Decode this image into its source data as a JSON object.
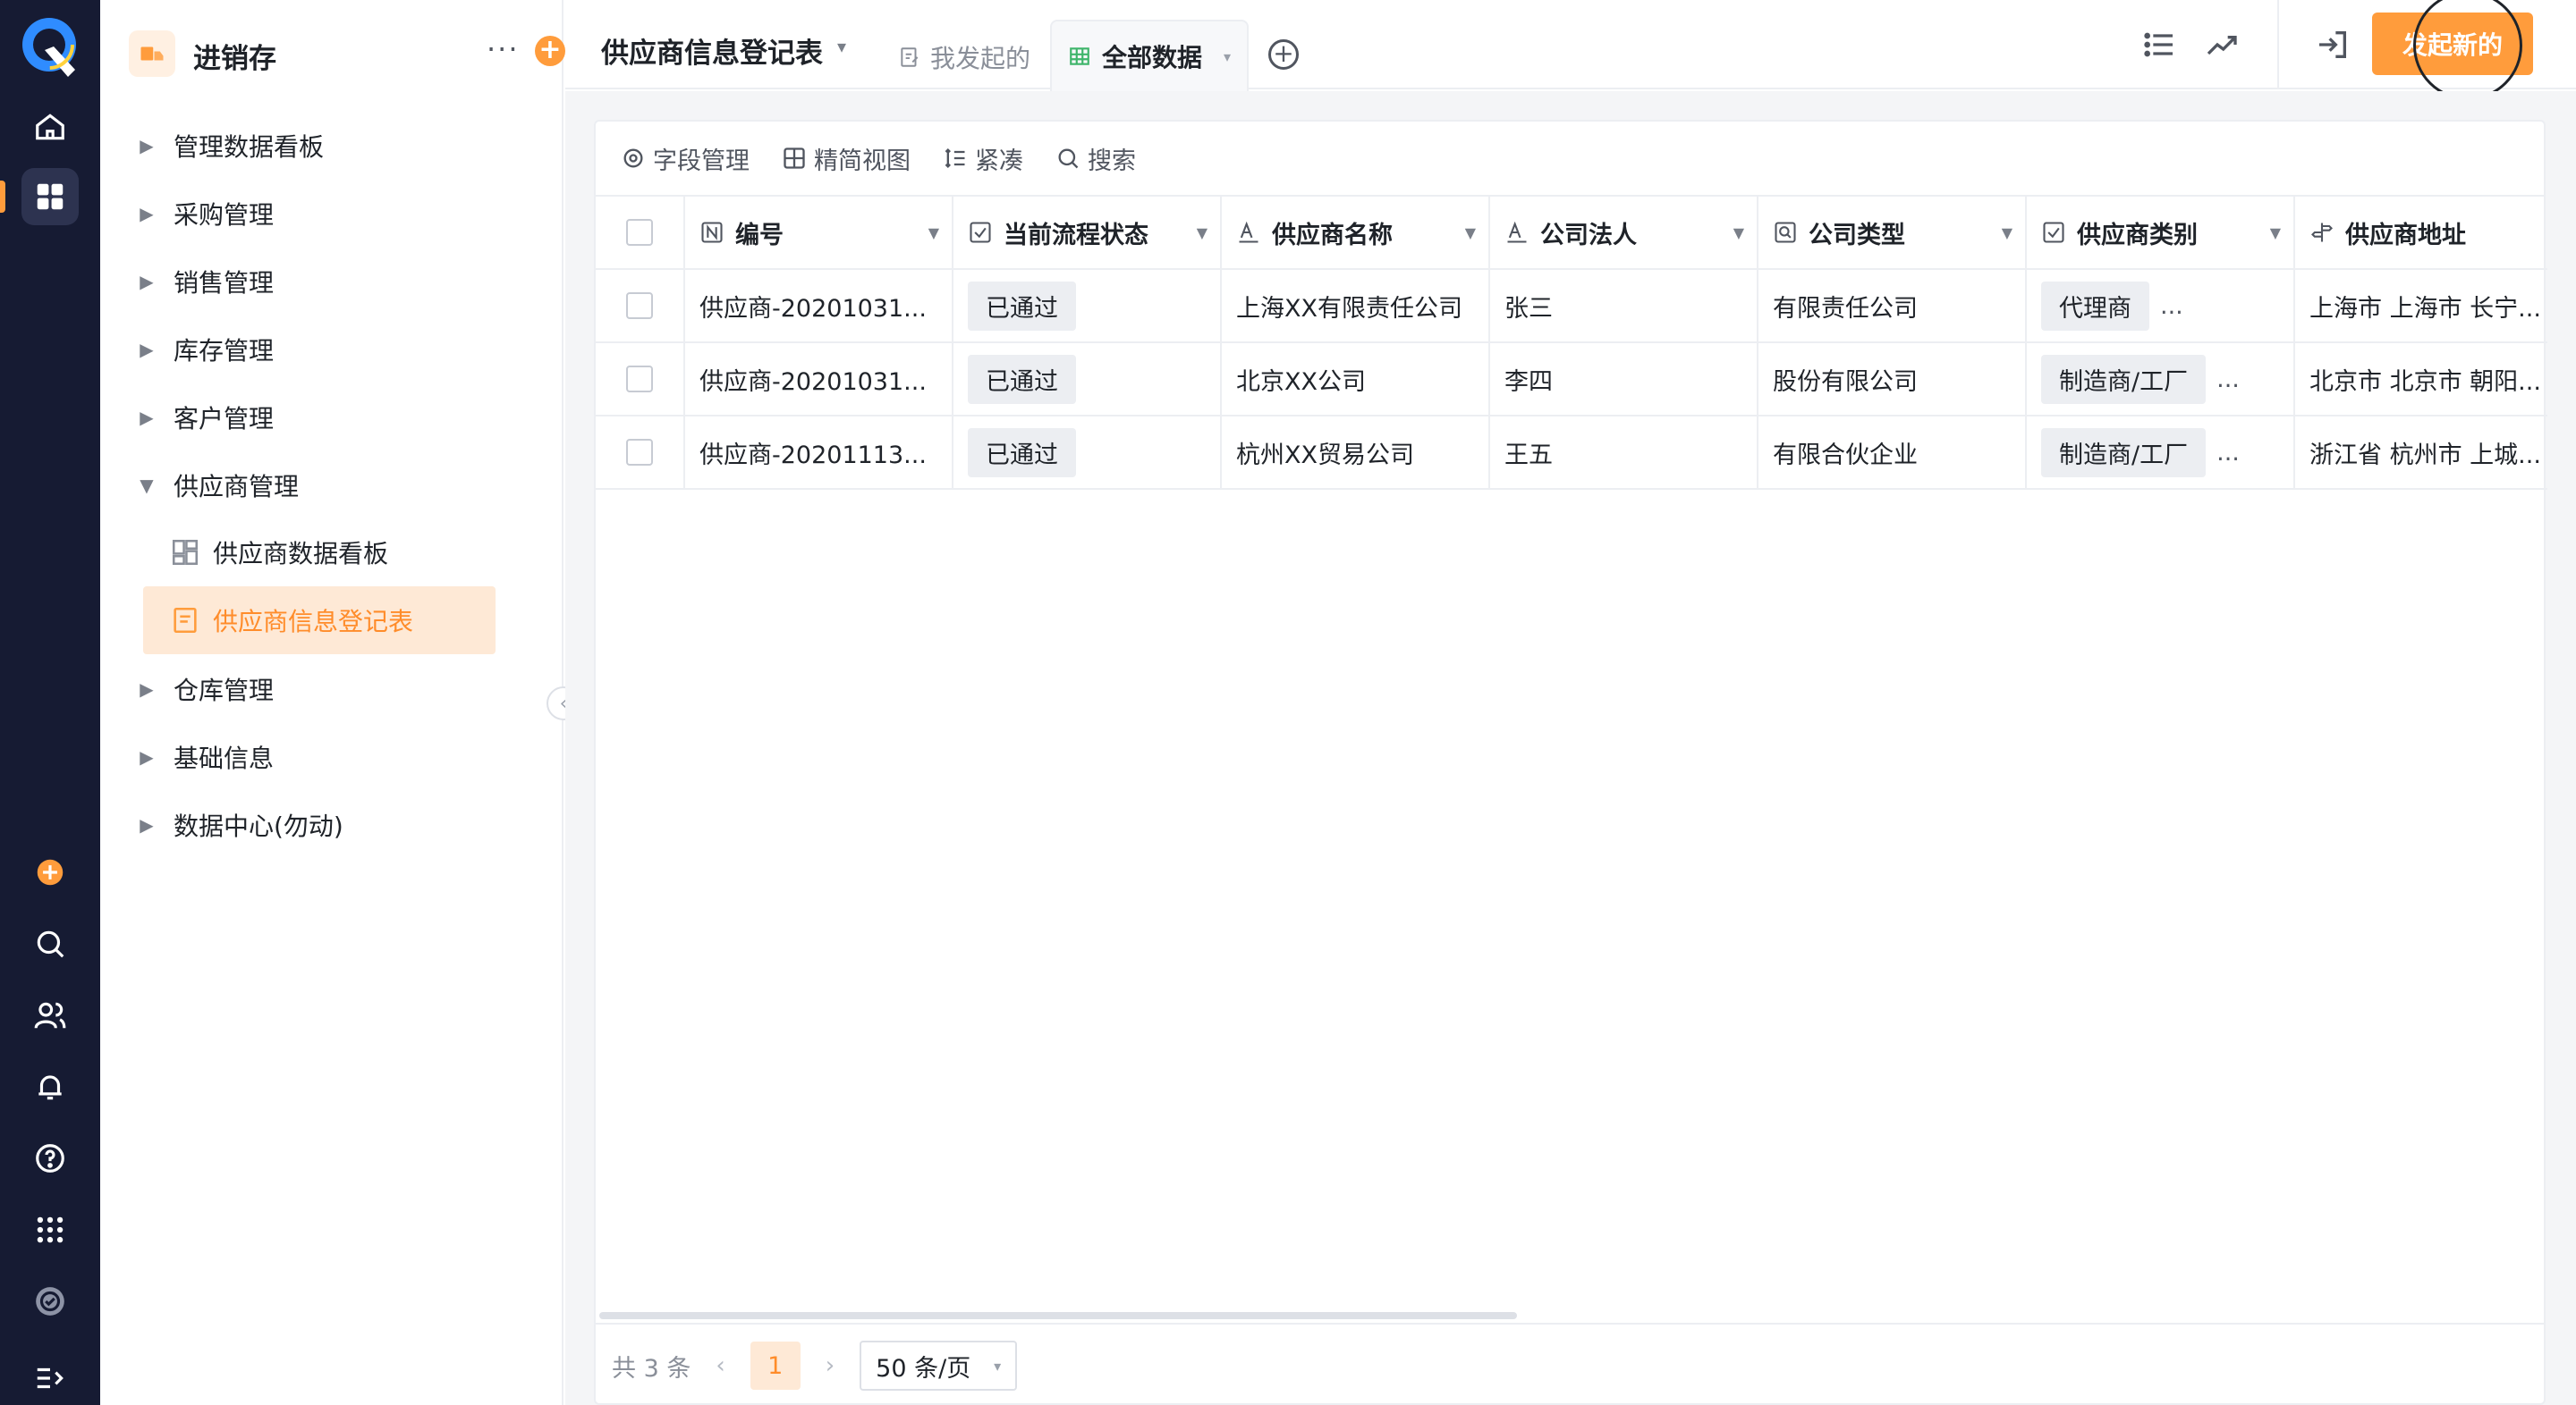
{
  "app": {
    "name": "进销存",
    "more_glyph": "···",
    "add_glyph": "+"
  },
  "sidebar": {
    "items": [
      {
        "label": "管理数据看板",
        "caret": "▶"
      },
      {
        "label": "采购管理",
        "caret": "▶"
      },
      {
        "label": "销售管理",
        "caret": "▶"
      },
      {
        "label": "库存管理",
        "caret": "▶"
      },
      {
        "label": "客户管理",
        "caret": "▶"
      },
      {
        "label": "供应商管理",
        "caret": "▼"
      },
      {
        "label": "仓库管理",
        "caret": "▶"
      },
      {
        "label": "基础信息",
        "caret": "▶"
      },
      {
        "label": "数据中心(勿动)",
        "caret": "▶"
      }
    ],
    "sub_items": [
      {
        "label": "供应商数据看板"
      },
      {
        "label": "供应商信息登记表"
      }
    ],
    "collapse_glyph": "‹"
  },
  "topbar": {
    "title": "供应商信息登记表",
    "title_caret": "▾",
    "tab_mine": "我发起的",
    "tab_all": "全部数据",
    "tab_all_caret": "▾",
    "tab_add_glyph": "+",
    "primary_button": "发起新的"
  },
  "toolbar": {
    "field_manage": "字段管理",
    "compact_view": "精简视图",
    "compact": "紧凑",
    "search": "搜索"
  },
  "table": {
    "columns": [
      {
        "label": "编号",
        "icon": "number-field-icon"
      },
      {
        "label": "当前流程状态",
        "icon": "checkbox-field-icon"
      },
      {
        "label": "供应商名称",
        "icon": "text-field-icon"
      },
      {
        "label": "公司法人",
        "icon": "text-field-icon"
      },
      {
        "label": "公司类型",
        "icon": "select-field-icon"
      },
      {
        "label": "供应商类别",
        "icon": "checkbox-field-icon"
      },
      {
        "label": "供应商地址",
        "icon": "address-field-icon"
      }
    ],
    "rows": [
      {
        "id": "供应商-20201031...",
        "status": "已通过",
        "name": "上海XX有限责任公司",
        "legal": "张三",
        "type": "有限责任公司",
        "category": "代理商",
        "more": "...",
        "address": "上海市 上海市 长宁..."
      },
      {
        "id": "供应商-20201031...",
        "status": "已通过",
        "name": "北京XX公司",
        "legal": "李四",
        "type": "股份有限公司",
        "category": "制造商/工厂",
        "more": "...",
        "address": "北京市 北京市 朝阳..."
      },
      {
        "id": "供应商-20201113...",
        "status": "已通过",
        "name": "杭州XX贸易公司",
        "legal": "王五",
        "type": "有限合伙企业",
        "category": "制造商/工厂",
        "more": "...",
        "address": "浙江省 杭州市 上城..."
      }
    ]
  },
  "footer": {
    "total": "共 3 条",
    "prev": "‹",
    "page": "1",
    "next": "›",
    "page_size": "50 条/页",
    "page_size_caret": "▾"
  },
  "colors": {
    "accent": "#ff9c3c",
    "rail_bg": "#161b33",
    "active_bg": "#fee9d6"
  }
}
